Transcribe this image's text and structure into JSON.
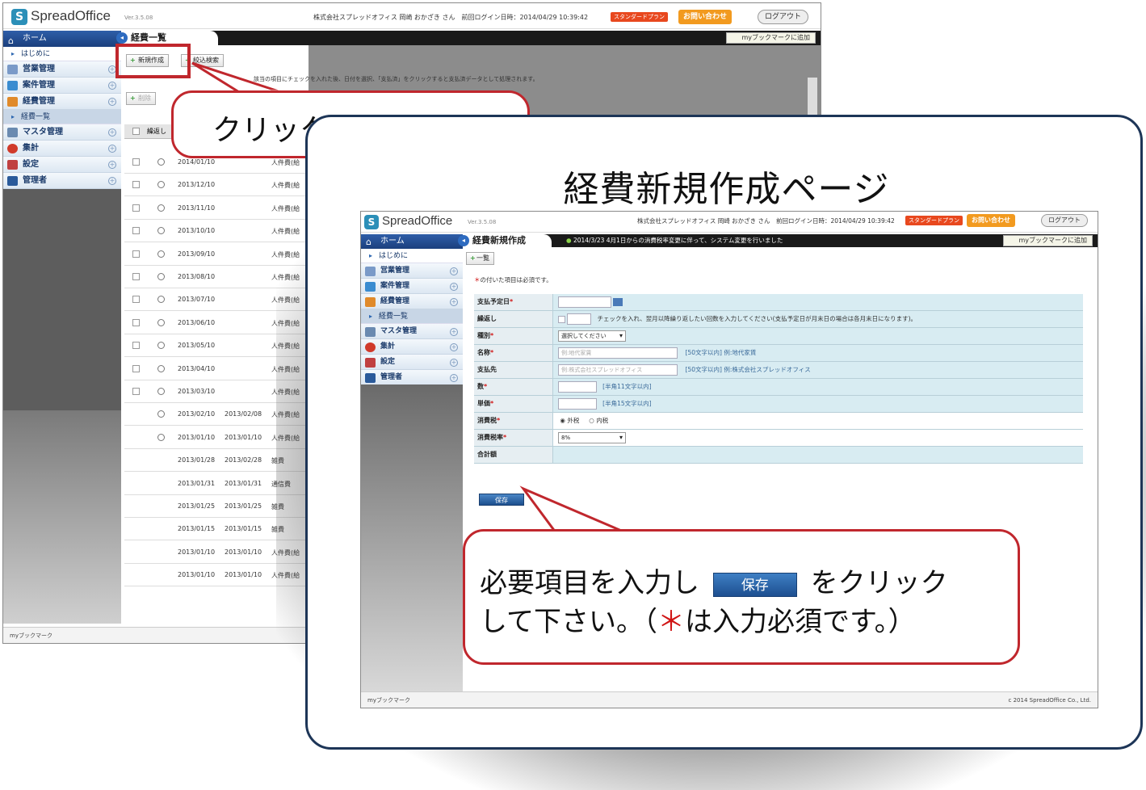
{
  "app": {
    "logo": "SpreadOffice",
    "version": "Ver.3.5.08",
    "user_info": "株式会社スプレッドオフィス 岡崎 おかざき さん　前回ログイン日時：2014/04/29 10:39:42",
    "plan_badge": "スタンダードプラン",
    "contact_button": "お問い合わせ",
    "logout_button": "ログアウト",
    "bookmark_button": "myブックマークに追加",
    "footer_bookmark": "myブックマーク",
    "copyright": "c 2014 SpreadOffice Co., Ltd."
  },
  "sidebar": {
    "home": "ホーム",
    "intro": "はじめに",
    "items": [
      "営業管理",
      "案件管理",
      "経費管理",
      "マスタ管理",
      "集計",
      "設定",
      "管理者"
    ],
    "active_sub": "経費一覧"
  },
  "back_page": {
    "tab_title": "経費一覧",
    "new_button": "新規作成",
    "filter_button": "絞込検索",
    "delete_button": "削除",
    "col_repeat": "繰返し",
    "info_text": "該当の項目にチェックを入れた後、日付を選択、「支払済」をクリックすると支払済データとして処理されます。",
    "rows": [
      {
        "d1": "2014/01/10",
        "d2": "",
        "type": "人件費(給"
      },
      {
        "d1": "2013/12/10",
        "d2": "",
        "type": "人件費(給"
      },
      {
        "d1": "2013/11/10",
        "d2": "",
        "type": "人件費(給"
      },
      {
        "d1": "2013/10/10",
        "d2": "",
        "type": "人件費(給"
      },
      {
        "d1": "2013/09/10",
        "d2": "",
        "type": "人件費(給"
      },
      {
        "d1": "2013/08/10",
        "d2": "",
        "type": "人件費(給"
      },
      {
        "d1": "2013/07/10",
        "d2": "",
        "type": "人件費(給"
      },
      {
        "d1": "2013/06/10",
        "d2": "",
        "type": "人件費(給"
      },
      {
        "d1": "2013/05/10",
        "d2": "",
        "type": "人件費(給"
      },
      {
        "d1": "2013/04/10",
        "d2": "",
        "type": "人件費(給"
      },
      {
        "d1": "2013/03/10",
        "d2": "",
        "type": "人件費(給"
      },
      {
        "d1": "2013/02/10",
        "d2": "2013/02/08",
        "type": "人件費(給"
      },
      {
        "d1": "2013/01/10",
        "d2": "2013/01/10",
        "type": "人件費(給"
      },
      {
        "d1": "2013/01/28",
        "d2": "2013/02/28",
        "type": "雑費"
      },
      {
        "d1": "2013/01/31",
        "d2": "2013/01/31",
        "type": "通信費"
      },
      {
        "d1": "2013/01/25",
        "d2": "2013/01/25",
        "type": "雑費"
      },
      {
        "d1": "2013/01/15",
        "d2": "2013/01/15",
        "type": "雑費"
      },
      {
        "d1": "2013/01/10",
        "d2": "2013/01/10",
        "type": "人件費(給"
      },
      {
        "d1": "2013/01/10",
        "d2": "2013/01/10",
        "type": "人件費(給"
      }
    ]
  },
  "callout1": "クリックして下さい。",
  "card_title": "経費新規作成ページ",
  "form_page": {
    "tab_title": "経費新規作成",
    "notice": "2014/3/23  4月1日からの消費税率変更に伴って、システム変更を行いました",
    "list_button": "一覧",
    "required_note": "の付いた項目は必須です。",
    "fields": [
      {
        "label": "支払予定日",
        "required": true
      },
      {
        "label": "繰返し",
        "required": false,
        "hint": "チェックを入れ、翌月以降繰り返したい回数を入力してください(支払予定日が月末日の場合は各月末日になります)。"
      },
      {
        "label": "種別",
        "required": true,
        "select": "選択してください"
      },
      {
        "label": "名称",
        "required": true,
        "placeholder": "例:地代家賃",
        "hint": "[50文字以内] 例:地代家賃"
      },
      {
        "label": "支払先",
        "required": false,
        "placeholder": "例:株式会社スプレッドオフィス",
        "hint": "[50文字以内] 例:株式会社スプレッドオフィス"
      },
      {
        "label": "数",
        "required": true,
        "hint": "[半角11文字以内]"
      },
      {
        "label": "単価",
        "required": true,
        "hint": "[半角15文字以内]"
      },
      {
        "label": "消費税",
        "required": true,
        "opt1": "外税",
        "opt2": "内税"
      },
      {
        "label": "消費税率",
        "required": true,
        "select": "8%"
      },
      {
        "label": "合計額",
        "required": false
      }
    ],
    "save_button": "保存"
  },
  "callout2": {
    "line1_a": "必要項目を入力し",
    "line1_b": "をクリック",
    "line2_a": "して下さい。（",
    "asterisk": "＊",
    "line2_b": "は入力必須です。）",
    "inline_button": "保存"
  }
}
